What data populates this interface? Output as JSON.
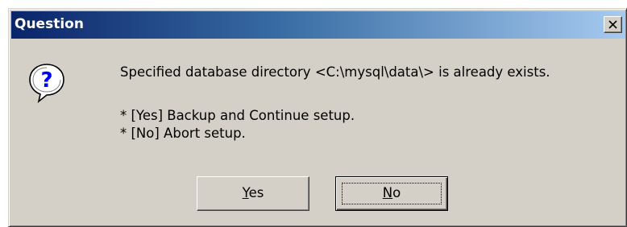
{
  "window": {
    "title": "Question",
    "close_icon": "close-icon"
  },
  "icon": {
    "name": "question-mark-icon",
    "glyph": "?"
  },
  "message": "Specified database directory <C:\\mysql\\data\\> is already exists.",
  "details": [
    "* [Yes] Backup and Continue setup.",
    "* [No]  Abort setup."
  ],
  "buttons": {
    "yes": {
      "mnemonic": "Y",
      "rest": "es"
    },
    "no": {
      "mnemonic": "N",
      "rest": "o"
    }
  },
  "colors": {
    "dialog_bg": "#d4d0c8",
    "title_gradient_start": "#0a246a",
    "title_gradient_end": "#a6caf0",
    "icon_accent": "#0000ff"
  }
}
